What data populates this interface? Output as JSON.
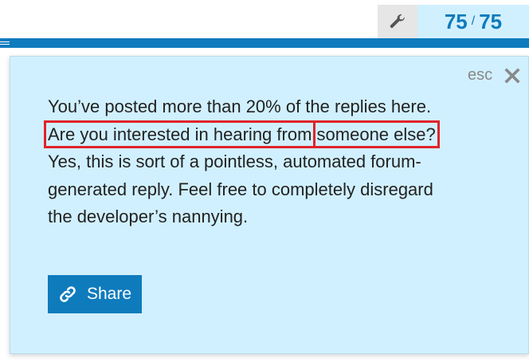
{
  "topic_progress": {
    "current": "75",
    "separator": "/",
    "total": "75",
    "fill_fraction": 1.0
  },
  "popup": {
    "esc_label": "esc",
    "message_part1": "You’ve posted more than 20% of the replies here.",
    "highlight_line1": "Are you interested in hearing from",
    "highlight_line2": "someone else?",
    "message_part2": "Yes, this is sort of a pointless, automated forum-generated reply. Feel free to completely disregard the developer’s nannying.",
    "share_label": "Share"
  },
  "icons": {
    "admin": "wrench-icon",
    "close": "close-icon",
    "share": "link-icon"
  },
  "colors": {
    "accent": "#0e7bbd",
    "popup_background": "#d1f0ff",
    "highlight_border": "#e0242a"
  }
}
